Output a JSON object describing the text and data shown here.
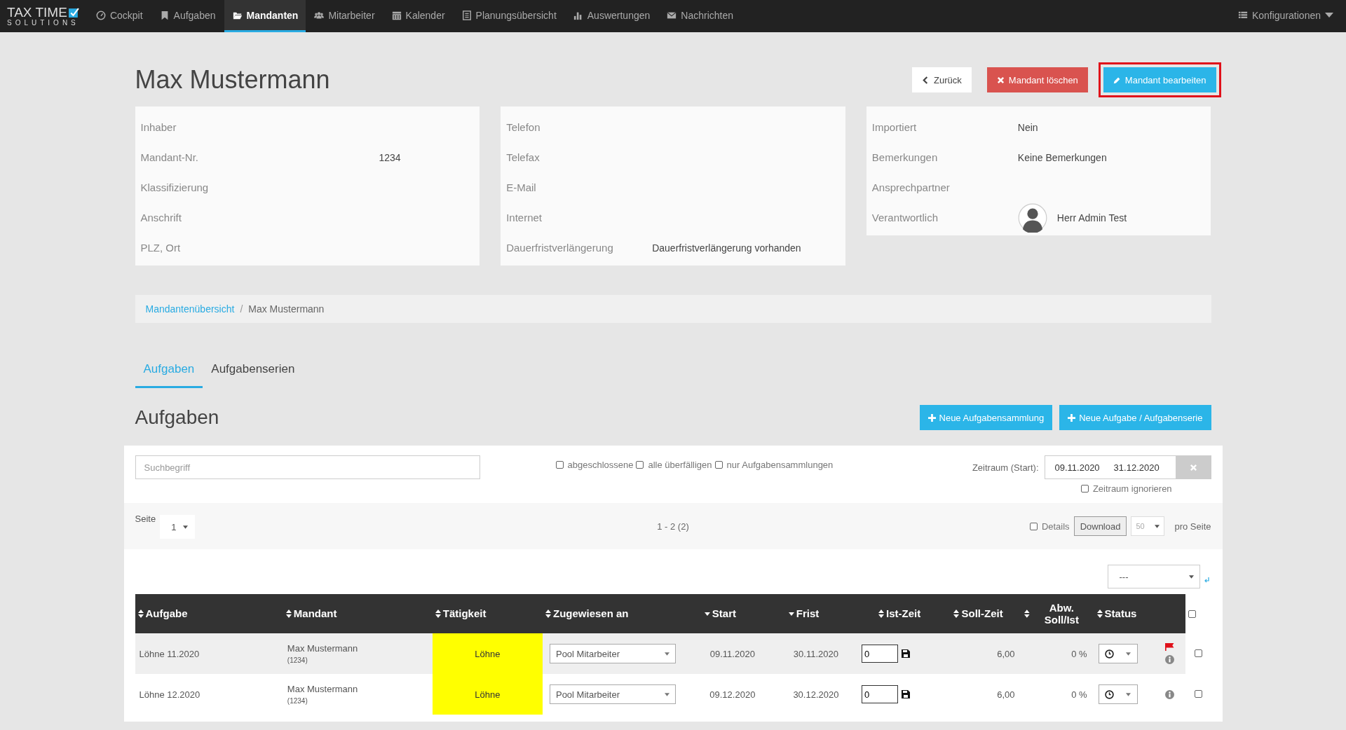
{
  "nav": {
    "brand_line1": "TAX TIME",
    "brand_line2": "SOLUTIONS",
    "items": [
      {
        "label": "Cockpit",
        "selected": false
      },
      {
        "label": "Aufgaben",
        "selected": false
      },
      {
        "label": "Mandanten",
        "selected": true
      },
      {
        "label": "Mitarbeiter",
        "selected": false
      },
      {
        "label": "Kalender",
        "selected": false
      },
      {
        "label": "Planungsübersicht",
        "selected": false
      },
      {
        "label": "Auswertungen",
        "selected": false
      },
      {
        "label": "Nachrichten",
        "selected": false
      }
    ],
    "config": "Konfigurationen"
  },
  "title": "Max Mustermann",
  "header_buttons": [
    {
      "label": "Zurück",
      "kind": "back",
      "highlighted": false
    },
    {
      "label": "Mandant löschen",
      "kind": "delete",
      "highlighted": false
    },
    {
      "label": "Mandant bearbeiten",
      "kind": "edit",
      "highlighted": true
    }
  ],
  "info_cards": [
    {
      "fields": [
        {
          "label": "Inhaber"
        },
        {
          "label": "Mandant-Nr.",
          "value": "1234"
        },
        {
          "label": "Klassifizierung"
        },
        {
          "label": "Anschrift"
        },
        {
          "label": "PLZ, Ort"
        }
      ]
    },
    {
      "fields": [
        {
          "label": "Telefon"
        },
        {
          "label": "Telefax"
        },
        {
          "label": "E-Mail"
        },
        {
          "label": "Internet"
        },
        {
          "label": "Dauerfristverlängerung",
          "value": "Dauerfristverlängerung vorhanden"
        }
      ]
    },
    {
      "fields": [
        {
          "label": "Importiert",
          "value": "Nein"
        },
        {
          "label": "Bemerkungen",
          "value": "Keine Bemerkungen"
        },
        {
          "label": "Ansprechpartner"
        },
        {
          "label": "Verantwortlich",
          "value": "Herr Admin Test",
          "avatar": true
        }
      ]
    }
  ],
  "breadcrumb_separator": "/",
  "breadcrumb": [
    {
      "label": "Mandantenübersicht",
      "link": true
    },
    {
      "label": "Max Mustermann",
      "link": false
    }
  ],
  "tabs": [
    {
      "label": "Aufgaben",
      "selected": true
    },
    {
      "label": "Aufgabenserien",
      "selected": false
    }
  ],
  "section_title": "Aufgaben",
  "section_buttons": [
    "Neue Aufgabensammlung",
    "Neue Aufgabe / Aufgabenserie"
  ],
  "filters": {
    "search_placeholder": "Suchbegriff",
    "checkboxes": [
      {
        "label": "abgeschlossene",
        "checked": false
      },
      {
        "label": "alle überfälligen",
        "checked": false
      },
      {
        "label": "nur Aufgabensammlungen",
        "checked": false
      }
    ],
    "range_label": "Zeitraum (Start):",
    "range_start": "09.11.2020",
    "range_end": "31.12.2020",
    "ignore_range": {
      "label": "Zeitraum ignorieren",
      "checked": false
    }
  },
  "pager": {
    "page_label": "Seite",
    "page": "1",
    "range": "1 - 2 (2)",
    "details": {
      "label": "Details",
      "checked": false
    },
    "download": "Download",
    "per_page": "50",
    "per_page_label": "pro Seite"
  },
  "bulk_action": "---",
  "table": {
    "columns": [
      {
        "label": "Aufgabe",
        "sorted": false
      },
      {
        "label": "Mandant",
        "sorted": false
      },
      {
        "label": "Tätigkeit",
        "sorted": false
      },
      {
        "label": "Zugewiesen an",
        "sorted": false
      },
      {
        "label": "Start",
        "sorted": true
      },
      {
        "label": "Frist",
        "sorted": true
      },
      {
        "label": "Ist-Zeit",
        "sorted": false
      },
      {
        "label": "Soll-Zeit",
        "sorted": false
      },
      {
        "label": "Abw. Soll/Ist",
        "sorted": false
      },
      {
        "label": "Status",
        "sorted": false
      }
    ],
    "all_checked": false,
    "rows": [
      {
        "task": "Löhne 11.2020",
        "client": "Max Mustermann",
        "client_no": "(1234)",
        "activity": "Löhne",
        "color": "#ffff00",
        "assignee": "Pool Mitarbeiter",
        "start": "09.11.2020",
        "due": "30.11.2020",
        "actual": "0",
        "target": "6,00",
        "deviation": "0 %",
        "flagged": true,
        "checked": false
      },
      {
        "task": "Löhne 12.2020",
        "client": "Max Mustermann",
        "client_no": "(1234)",
        "activity": "Löhne",
        "color": "#ffff00",
        "assignee": "Pool Mitarbeiter",
        "start": "09.12.2020",
        "due": "30.12.2020",
        "actual": "0",
        "target": "6,00",
        "deviation": "0 %",
        "flagged": false,
        "checked": false
      }
    ]
  }
}
